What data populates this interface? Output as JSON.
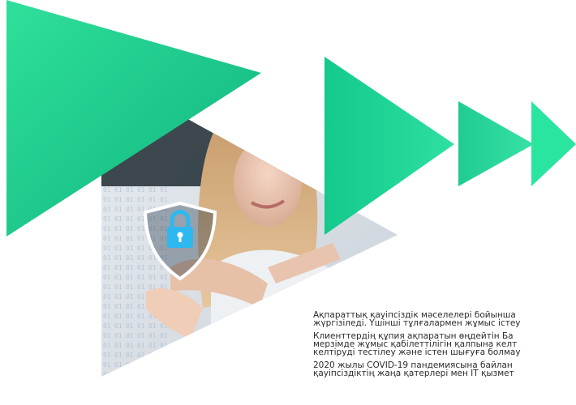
{
  "graphic": {
    "icon": "shield-lock-icon",
    "colors": {
      "accent_green": "#1ec98a",
      "accent_teal": "#0ea67b",
      "shield_blue": "#2db8f0",
      "photo_bg": "#dfe5ea"
    }
  },
  "text": {
    "p1": {
      "l1": "Ақпараттық қауіпсіздік мәселелері бойынша",
      "l2": "жүргізіледі. Үшінші тұлғалармен жұмыс істеу"
    },
    "p2": {
      "l1": "Клиенттердің құпия ақпаратын өңдейтін Ба",
      "l2": "мерзімде жұмыс қабілеттілігін қалпына келт",
      "l3": "келтіруді тестілеу және істен шығуға болмау"
    },
    "p3": {
      "l1": "2020 жылы COVID-19 пандемиясына байлан",
      "l2": "қауіпсіздіктің жаңа қатерлері мен IT қызмет"
    }
  }
}
